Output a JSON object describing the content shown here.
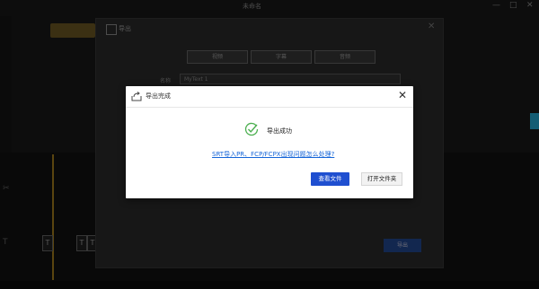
{
  "background_app": {
    "title": "未命名",
    "window_controls": [
      "—",
      "□",
      "✕"
    ],
    "export_dialog": {
      "title": "导出",
      "tabs": [
        "视频",
        "字幕",
        "音频"
      ],
      "name_label": "名称",
      "name_value": "MyText 1",
      "export_button": "导出"
    },
    "track_labels": [
      "T",
      "T",
      "T"
    ]
  },
  "modal": {
    "title": "导出完成",
    "close_symbol": "✕",
    "success_message": "导出成功",
    "help_link": "SRT导入PR、FCP/FCPX出现问题怎么处理?",
    "primary_button": "查看文件",
    "secondary_button": "打开文件夹"
  },
  "colors": {
    "primary_button": "#1f4fd0",
    "link": "#1565d8",
    "success_check": "#4caf50"
  },
  "icons": {
    "header": "export-share-icon",
    "success": "check-circle-icon",
    "close": "close-icon"
  }
}
